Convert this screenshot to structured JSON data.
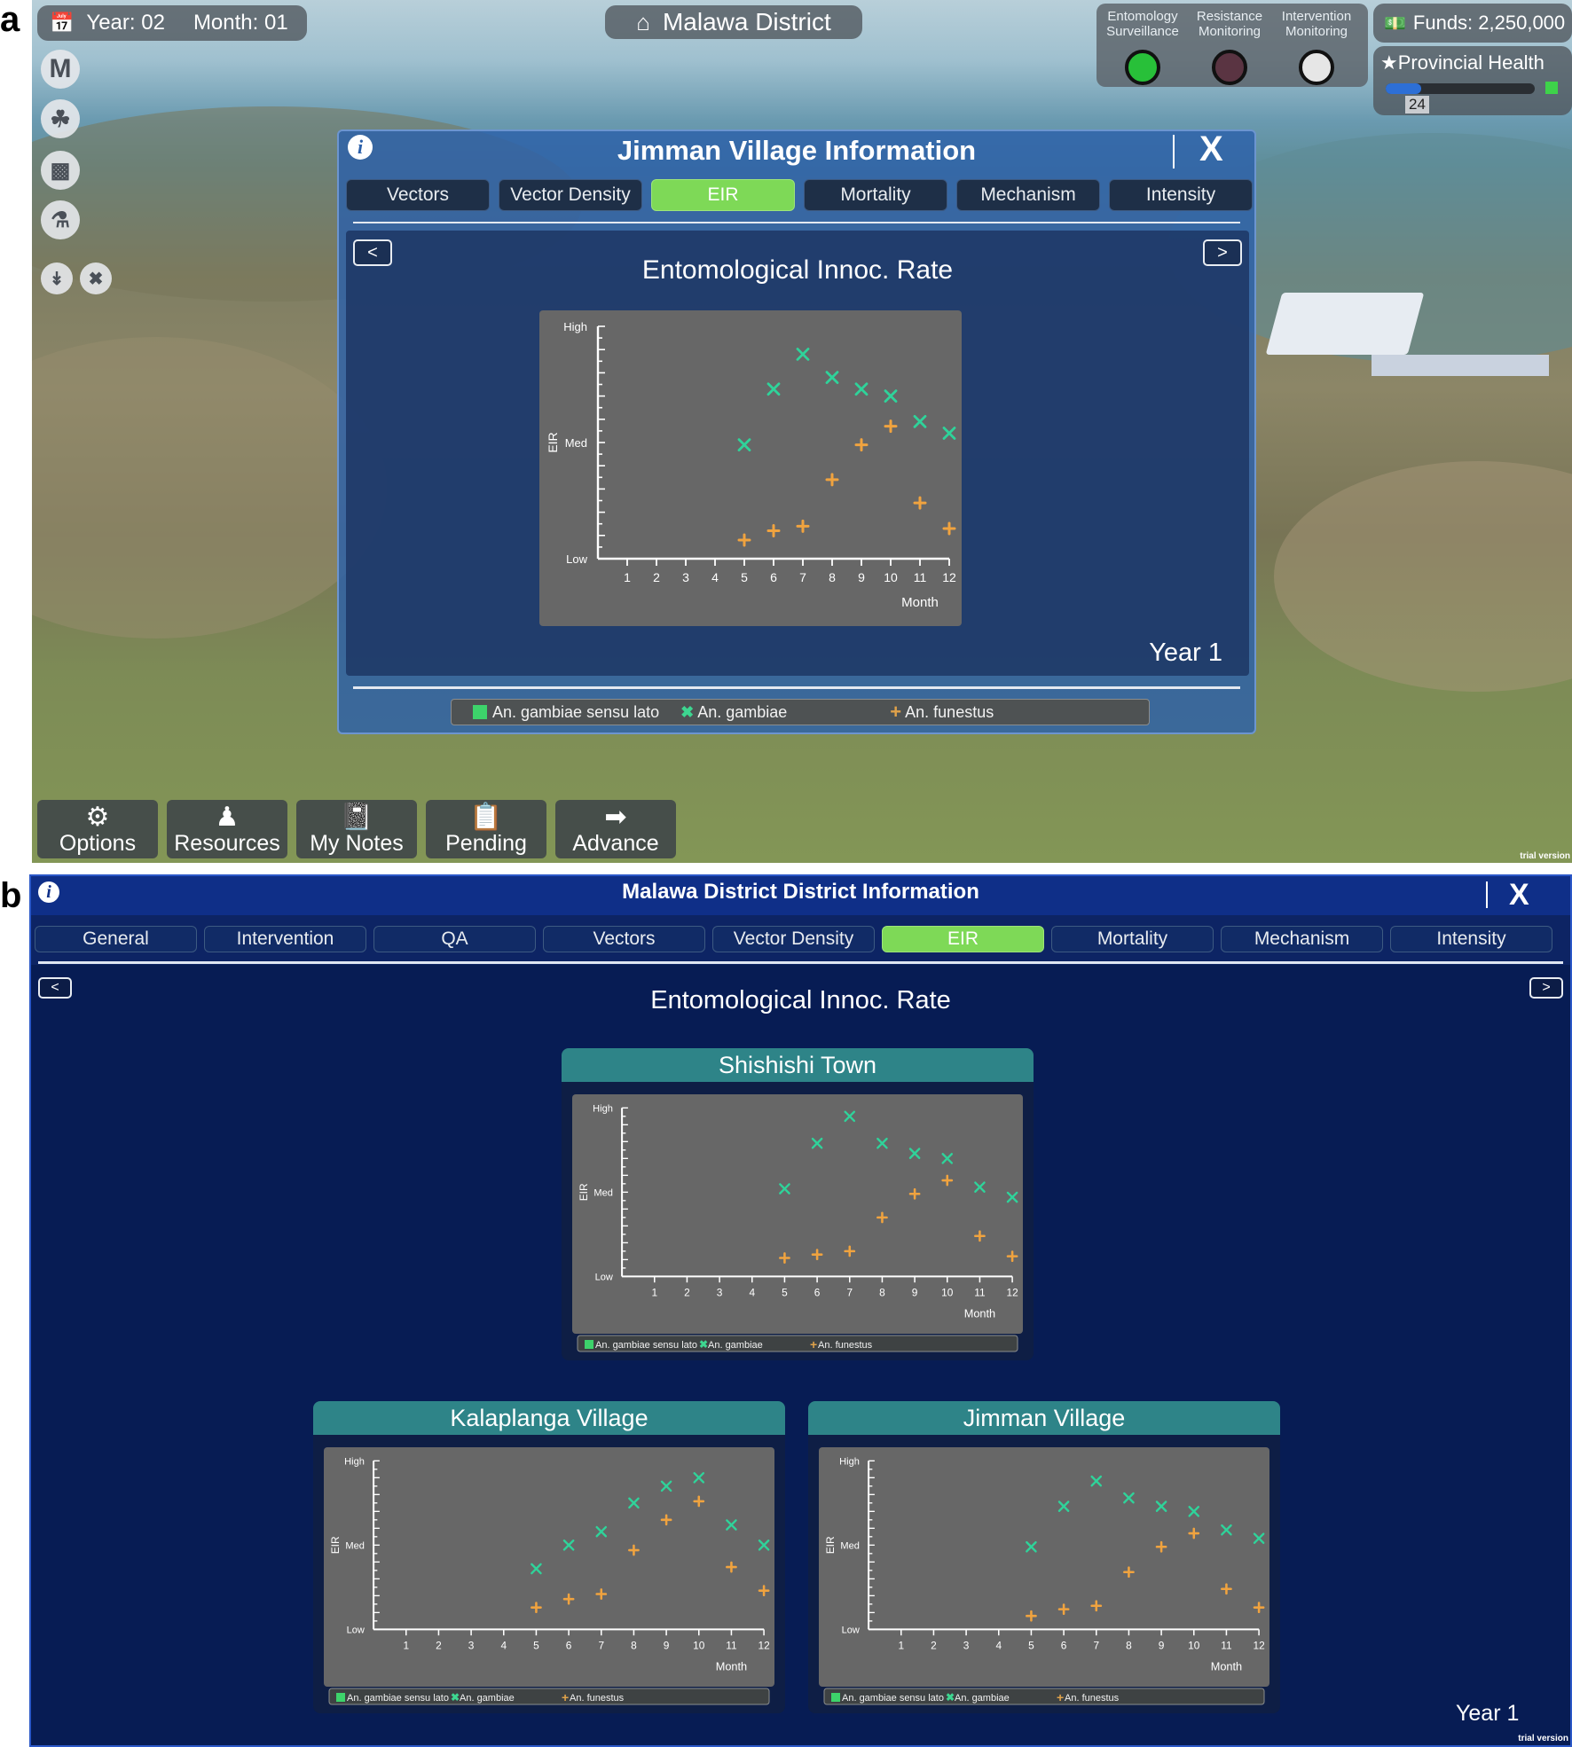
{
  "labels": {
    "a": "a",
    "b": "b"
  },
  "colors": {
    "green_mark": "#2fd39a",
    "orange_mark": "#f0a33f",
    "active_tab": "#7ed957",
    "chart_bg": "#676767"
  },
  "panel_a": {
    "date": {
      "year": "Year: 02",
      "month": "Month: 01"
    },
    "district": "Malawa District",
    "monitoring": [
      {
        "label": [
          "Entomology",
          "Surveillance"
        ],
        "color": "#28c039"
      },
      {
        "label": [
          "Resistance",
          "Monitoring"
        ],
        "color": "#5a3442"
      },
      {
        "label": [
          "Intervention",
          "Monitoring"
        ],
        "color": "#e6e6e6"
      }
    ],
    "funds": "Funds: 2,250,000",
    "provincial": {
      "label": "Provincial Health",
      "value": "24"
    },
    "side_icons": [
      "M"
    ],
    "window": {
      "title": "Jimman Village Information",
      "close": "X",
      "tabs": [
        "Vectors",
        "Vector Density",
        "EIR",
        "Mortality",
        "Mechanism",
        "Intensity"
      ],
      "active_tab": "EIR",
      "chart_title": "Entomological Innoc. Rate",
      "prev": "<",
      "next": ">",
      "year": "Year 1",
      "legend": [
        "An. gambiae sensu lato",
        "An. gambiae",
        "An. funestus"
      ]
    },
    "buttons": [
      "Options",
      "Resources",
      "My Notes",
      "Pending",
      "Advance"
    ],
    "watermark": "trial version"
  },
  "panel_b": {
    "title": "Malawa District District Information",
    "close": "X",
    "tabs": [
      "General",
      "Intervention",
      "QA",
      "Vectors",
      "Vector Density",
      "EIR",
      "Mortality",
      "Mechanism",
      "Intensity"
    ],
    "active_tab": "EIR",
    "chart_title": "Entomological Innoc. Rate",
    "prev": "<",
    "next": ">",
    "year": "Year 1",
    "watermark": "trial version",
    "subwindows": [
      "Shishishi Town",
      "Kalaplanga Village",
      "Jimman Village"
    ]
  },
  "chart_data": [
    {
      "type": "scatter",
      "title": "Jimman Village",
      "xlabel": "Month",
      "ylabel": "EIR",
      "x": [
        1,
        2,
        3,
        4,
        5,
        6,
        7,
        8,
        9,
        10,
        11,
        12
      ],
      "xlim": [
        0,
        12
      ],
      "y_ticks": [
        "Low",
        "Med",
        "High"
      ],
      "ylim": [
        0,
        10
      ],
      "series": [
        {
          "name": "An. gambiae sensu lato",
          "values": []
        },
        {
          "name": "An. gambiae",
          "marker": "x",
          "x": [
            5,
            6,
            7,
            8,
            9,
            10,
            11,
            12
          ],
          "values": [
            4.9,
            7.3,
            8.8,
            7.8,
            7.3,
            7.0,
            5.9,
            5.4
          ]
        },
        {
          "name": "An. funestus",
          "marker": "+",
          "x": [
            5,
            6,
            7,
            8,
            9,
            10,
            11,
            12
          ],
          "values": [
            0.8,
            1.2,
            1.4,
            3.4,
            4.9,
            5.7,
            2.4,
            1.3
          ]
        }
      ]
    },
    {
      "type": "scatter",
      "title": "Shishishi Town",
      "xlabel": "Month",
      "ylabel": "EIR",
      "x": [
        1,
        2,
        3,
        4,
        5,
        6,
        7,
        8,
        9,
        10,
        11,
        12
      ],
      "xlim": [
        0,
        12
      ],
      "y_ticks": [
        "Low",
        "Med",
        "High"
      ],
      "ylim": [
        0,
        10
      ],
      "series": [
        {
          "name": "An. gambiae sensu lato",
          "values": []
        },
        {
          "name": "An. gambiae",
          "marker": "x",
          "x": [
            5,
            6,
            7,
            8,
            9,
            10,
            11,
            12
          ],
          "values": [
            5.2,
            7.9,
            9.5,
            7.9,
            7.3,
            7.0,
            5.3,
            4.7
          ]
        },
        {
          "name": "An. funestus",
          "marker": "+",
          "x": [
            5,
            6,
            7,
            8,
            9,
            10,
            11,
            12
          ],
          "values": [
            1.1,
            1.3,
            1.5,
            3.5,
            4.9,
            5.7,
            2.4,
            1.2
          ]
        }
      ]
    },
    {
      "type": "scatter",
      "title": "Kalaplanga Village",
      "xlabel": "Month",
      "ylabel": "EIR",
      "x": [
        1,
        2,
        3,
        4,
        5,
        6,
        7,
        8,
        9,
        10,
        11,
        12
      ],
      "xlim": [
        0,
        12
      ],
      "y_ticks": [
        "Low",
        "Med",
        "High"
      ],
      "ylim": [
        0,
        10
      ],
      "series": [
        {
          "name": "An. gambiae sensu lato",
          "values": []
        },
        {
          "name": "An. gambiae",
          "marker": "x",
          "x": [
            5,
            6,
            7,
            8,
            9,
            10,
            11,
            12
          ],
          "values": [
            3.6,
            5.0,
            5.8,
            7.5,
            8.5,
            9.0,
            6.2,
            5.0
          ]
        },
        {
          "name": "An. funestus",
          "marker": "+",
          "x": [
            5,
            6,
            7,
            8,
            9,
            10,
            11,
            12
          ],
          "values": [
            1.3,
            1.8,
            2.1,
            4.7,
            6.5,
            7.6,
            3.7,
            2.3
          ]
        }
      ]
    },
    {
      "type": "scatter",
      "title": "Jimman Village",
      "xlabel": "Month",
      "ylabel": "EIR",
      "x": [
        1,
        2,
        3,
        4,
        5,
        6,
        7,
        8,
        9,
        10,
        11,
        12
      ],
      "xlim": [
        0,
        12
      ],
      "y_ticks": [
        "Low",
        "Med",
        "High"
      ],
      "ylim": [
        0,
        10
      ],
      "series": [
        {
          "name": "An. gambiae sensu lato",
          "values": []
        },
        {
          "name": "An. gambiae",
          "marker": "x",
          "x": [
            5,
            6,
            7,
            8,
            9,
            10,
            11,
            12
          ],
          "values": [
            4.9,
            7.3,
            8.8,
            7.8,
            7.3,
            7.0,
            5.9,
            5.4
          ]
        },
        {
          "name": "An. funestus",
          "marker": "+",
          "x": [
            5,
            6,
            7,
            8,
            9,
            10,
            11,
            12
          ],
          "values": [
            0.8,
            1.2,
            1.4,
            3.4,
            4.9,
            5.7,
            2.4,
            1.3
          ]
        }
      ]
    }
  ]
}
